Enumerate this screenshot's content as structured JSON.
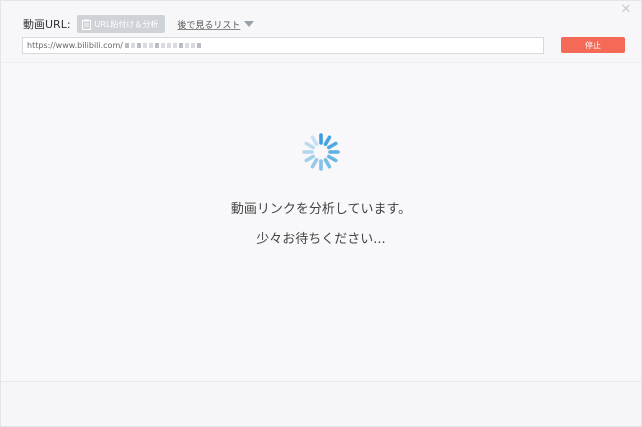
{
  "header": {
    "url_label": "動画URL:",
    "paste_button_label": "URL貼付け＆分析",
    "watch_later_label": "後で見るリスト",
    "stop_button_label": "停止"
  },
  "url_input": {
    "value": "https://www.bilibili.com/"
  },
  "status": {
    "analyzing_message": "動画リンクを分析しています。",
    "please_wait_message": "少々お待ちください..."
  },
  "colors": {
    "accent": "#f46a56",
    "spinner": "#3aa0dc"
  },
  "icons": {
    "close": "close-icon",
    "paste": "clipboard-icon",
    "dropdown": "chevron-down-icon",
    "spinner": "loading-spinner-icon"
  }
}
